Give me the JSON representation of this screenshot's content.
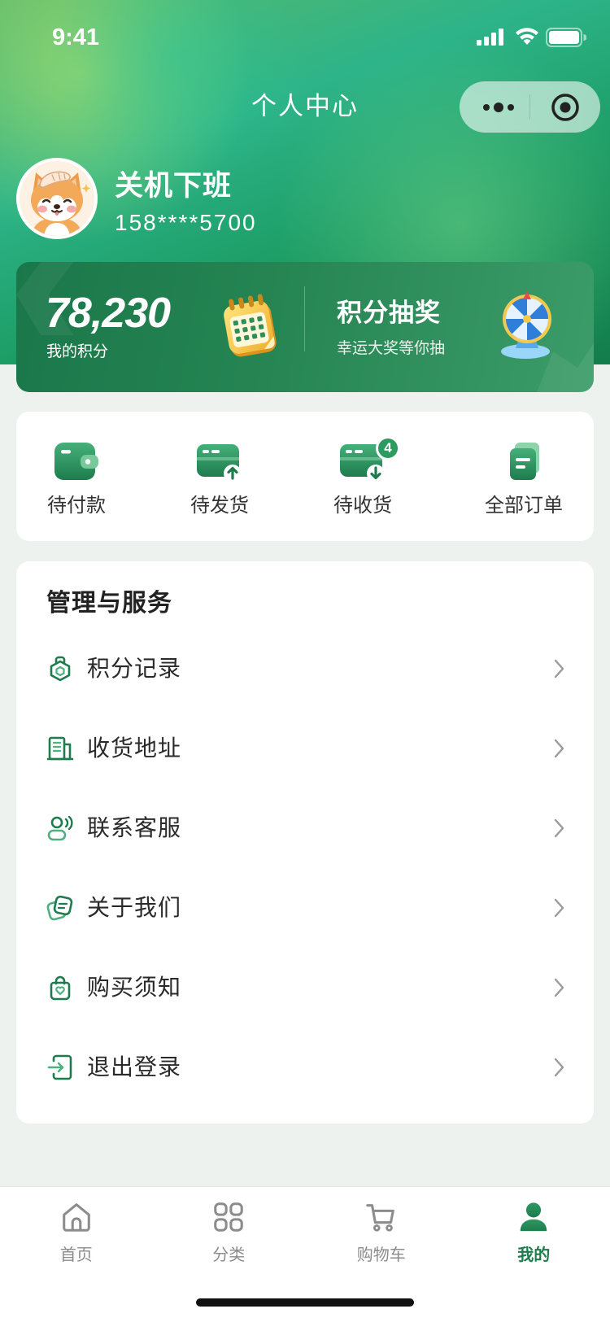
{
  "status_bar": {
    "time": "9:41",
    "icons": [
      "cellular-signal-icon",
      "wifi-icon",
      "battery-icon"
    ]
  },
  "header": {
    "title": "个人中心"
  },
  "capsule": {
    "icons": [
      "more-dots-icon",
      "close-target-icon"
    ]
  },
  "profile": {
    "name": "关机下班",
    "phone": "158****5700"
  },
  "points_card": {
    "points": "78,230",
    "points_label": "我的积分",
    "points_icon": "calendar-icon",
    "lottery_title": "积分抽奖",
    "lottery_subtitle": "幸运大奖等你抽",
    "lottery_icon": "prize-wheel-icon"
  },
  "orders": [
    {
      "label": "待付款",
      "icon": "wallet-icon"
    },
    {
      "label": "待发货",
      "icon": "shipping-card-icon"
    },
    {
      "label": "待收货",
      "icon": "receiving-card-icon",
      "badge": "4"
    },
    {
      "label": "全部订单",
      "icon": "order-list-icon"
    }
  ],
  "services": {
    "title": "管理与服务",
    "items": [
      {
        "label": "积分记录",
        "icon": "points-badge-icon"
      },
      {
        "label": "收货地址",
        "icon": "building-icon"
      },
      {
        "label": "联系客服",
        "icon": "customer-service-icon"
      },
      {
        "label": "关于我们",
        "icon": "about-cards-icon"
      },
      {
        "label": "购买须知",
        "icon": "shopping-bag-icon"
      },
      {
        "label": "退出登录",
        "icon": "logout-icon"
      }
    ]
  },
  "tabbar": {
    "items": [
      {
        "label": "首页",
        "icon": "home-icon",
        "active": false
      },
      {
        "label": "分类",
        "icon": "category-grid-icon",
        "active": false
      },
      {
        "label": "购物车",
        "icon": "cart-icon",
        "active": false
      },
      {
        "label": "我的",
        "icon": "user-icon",
        "active": true
      }
    ]
  },
  "colors": {
    "primary": "#1c7c4c",
    "primary_light": "#3ea86f",
    "page_background": "#eef2ef",
    "text_primary": "#2a2a2a",
    "tab_inactive": "#8c8c8c",
    "badge": "#2e9a60"
  }
}
